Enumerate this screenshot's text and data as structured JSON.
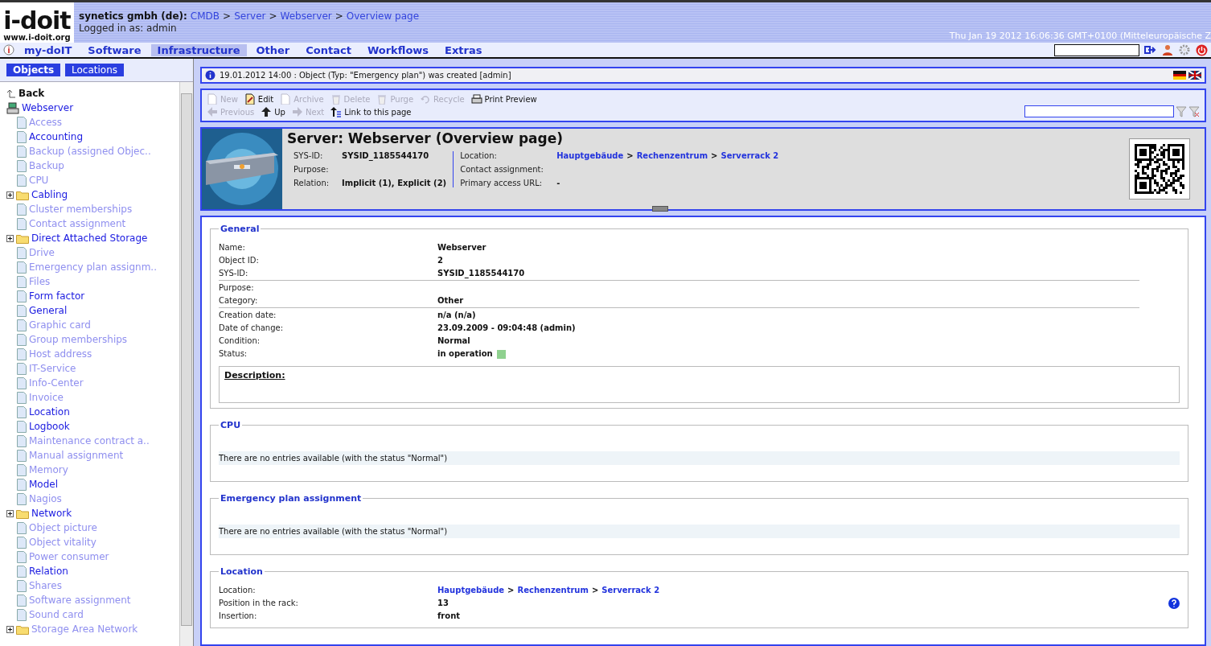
{
  "header": {
    "logo": "i-doit",
    "logo_url": "www.i-doit.org",
    "company": "synetics gmbh (de):",
    "breadcrumb": [
      "CMDB",
      "Server",
      "Webserver",
      "Overview page"
    ],
    "breadcrumb_separator": ">",
    "login": "Logged in as: admin",
    "datetime": "Thu Jan 19 2012 16:06:36 GMT+0100 (Mitteleuropäische Z"
  },
  "nav": {
    "items": [
      {
        "label": "my-doIT",
        "selected": false
      },
      {
        "label": "Software",
        "selected": false
      },
      {
        "label": "Infrastructure",
        "selected": true
      },
      {
        "label": "Other",
        "selected": false
      },
      {
        "label": "Contact",
        "selected": false
      },
      {
        "label": "Workflows",
        "selected": false
      },
      {
        "label": "Extras",
        "selected": false
      }
    ]
  },
  "sidebar": {
    "tabs": [
      {
        "label": "Objects",
        "selected": true
      },
      {
        "label": "Locations",
        "selected": false
      }
    ],
    "back": "Back",
    "root": "Webserver",
    "items": [
      {
        "label": "Access",
        "kind": "page",
        "filled": false
      },
      {
        "label": "Accounting",
        "kind": "page",
        "filled": true
      },
      {
        "label": "Backup (assigned Objec..",
        "kind": "page",
        "filled": false
      },
      {
        "label": "Backup",
        "kind": "page",
        "filled": false
      },
      {
        "label": "CPU",
        "kind": "page",
        "filled": false
      },
      {
        "label": "Cabling",
        "kind": "folder",
        "filled": true,
        "expanded": false
      },
      {
        "label": "Cluster memberships",
        "kind": "page",
        "filled": false
      },
      {
        "label": "Contact assignment",
        "kind": "page",
        "filled": false
      },
      {
        "label": "Direct Attached Storage",
        "kind": "folder",
        "filled": true,
        "expanded": false
      },
      {
        "label": "Drive",
        "kind": "page",
        "filled": false
      },
      {
        "label": "Emergency plan assignm..",
        "kind": "page",
        "filled": false
      },
      {
        "label": "Files",
        "kind": "page",
        "filled": false
      },
      {
        "label": "Form factor",
        "kind": "page",
        "filled": true
      },
      {
        "label": "General",
        "kind": "page",
        "filled": true
      },
      {
        "label": "Graphic card",
        "kind": "page",
        "filled": false
      },
      {
        "label": "Group memberships",
        "kind": "page",
        "filled": false
      },
      {
        "label": "Host address",
        "kind": "page",
        "filled": false
      },
      {
        "label": "IT-Service",
        "kind": "page",
        "filled": false
      },
      {
        "label": "Info-Center",
        "kind": "page",
        "filled": false
      },
      {
        "label": "Invoice",
        "kind": "page",
        "filled": false
      },
      {
        "label": "Location",
        "kind": "page",
        "filled": true
      },
      {
        "label": "Logbook",
        "kind": "page",
        "filled": true
      },
      {
        "label": "Maintenance contract a..",
        "kind": "page",
        "filled": false
      },
      {
        "label": "Manual assignment",
        "kind": "page",
        "filled": false
      },
      {
        "label": "Memory",
        "kind": "page",
        "filled": false
      },
      {
        "label": "Model",
        "kind": "page",
        "filled": true
      },
      {
        "label": "Nagios",
        "kind": "page",
        "filled": false
      },
      {
        "label": "Network",
        "kind": "folder",
        "filled": true,
        "expanded": false
      },
      {
        "label": "Object picture",
        "kind": "page",
        "filled": false
      },
      {
        "label": "Object vitality",
        "kind": "page",
        "filled": false
      },
      {
        "label": "Power consumer",
        "kind": "page",
        "filled": false
      },
      {
        "label": "Relation",
        "kind": "page",
        "filled": true
      },
      {
        "label": "Shares",
        "kind": "page",
        "filled": false
      },
      {
        "label": "Software assignment",
        "kind": "page",
        "filled": false
      },
      {
        "label": "Sound card",
        "kind": "page",
        "filled": false
      },
      {
        "label": "Storage Area Network",
        "kind": "folder",
        "filled": false,
        "expanded": false
      }
    ]
  },
  "message": "19.01.2012 14:00 : Object (Typ: \"Emergency plan\") was created [admin]",
  "toolbar": {
    "rows": [
      [
        {
          "label": "New",
          "kind": "page",
          "disabled": true
        },
        {
          "label": "Edit",
          "kind": "edit",
          "disabled": false
        },
        {
          "label": "Archive",
          "kind": "page",
          "disabled": true
        },
        {
          "label": "Delete",
          "kind": "trash",
          "disabled": true
        },
        {
          "label": "Purge",
          "kind": "trash",
          "disabled": true
        },
        {
          "label": "Recycle",
          "kind": "recycle",
          "disabled": true
        },
        {
          "label": "Print Preview",
          "kind": "print",
          "disabled": false
        }
      ],
      [
        {
          "label": "Previous",
          "kind": "left",
          "disabled": true
        },
        {
          "label": "Up",
          "kind": "up",
          "disabled": false
        },
        {
          "label": "Next",
          "kind": "right",
          "disabled": true
        },
        {
          "label": "Link to this page",
          "kind": "link",
          "disabled": false
        }
      ]
    ]
  },
  "object": {
    "title": "Server: Webserver (Overview page)",
    "left": [
      {
        "label": "SYS-ID:",
        "value": "SYSID_1185544170"
      },
      {
        "label": "Purpose:"
      },
      {
        "label": "Relation:",
        "value": "Implicit (1), Explicit (2)"
      }
    ],
    "right": [
      {
        "label": "Location:",
        "links": [
          "Hauptgebäude",
          "Rechenzentrum",
          "Serverrack 2"
        ],
        "separator": ">"
      },
      {
        "label": "Contact assignment:"
      },
      {
        "label": "Primary access URL:",
        "value": "-"
      }
    ]
  },
  "sections": [
    {
      "kind": "fields",
      "title": "General",
      "groups": [
        [
          {
            "label": "Name:",
            "value": "Webserver"
          },
          {
            "label": "Object ID:",
            "value": "2"
          },
          {
            "label": "SYS-ID:",
            "value": "SYSID_1185544170"
          }
        ],
        [
          {
            "label": "Purpose:"
          },
          {
            "label": "Category:",
            "value": "Other"
          }
        ],
        [
          {
            "label": "Creation date:",
            "value": "n/a (n/a)"
          },
          {
            "label": "Date of change:",
            "value": "23.09.2009 - 09:04:48 (admin)"
          },
          {
            "label": "Condition:",
            "value": "Normal"
          },
          {
            "label": "Status:",
            "value": "in operation",
            "color": "#8fd18f"
          }
        ]
      ],
      "description": "Description:"
    },
    {
      "kind": "empty",
      "title": "CPU",
      "text": "There are no entries available (with the status \"Normal\")"
    },
    {
      "kind": "empty",
      "title": "Emergency plan assignment",
      "text": "There are no entries available (with the status \"Normal\")"
    },
    {
      "kind": "fields",
      "title": "Location",
      "help": true,
      "groups": [
        [
          {
            "label": "Location:",
            "links": [
              "Hauptgebäude",
              "Rechenzentrum",
              "Serverrack 2"
            ],
            "separator": ">"
          },
          {
            "label": "Position in the rack:",
            "value": "13"
          },
          {
            "label": "Insertion:",
            "value": "front"
          }
        ]
      ]
    }
  ]
}
